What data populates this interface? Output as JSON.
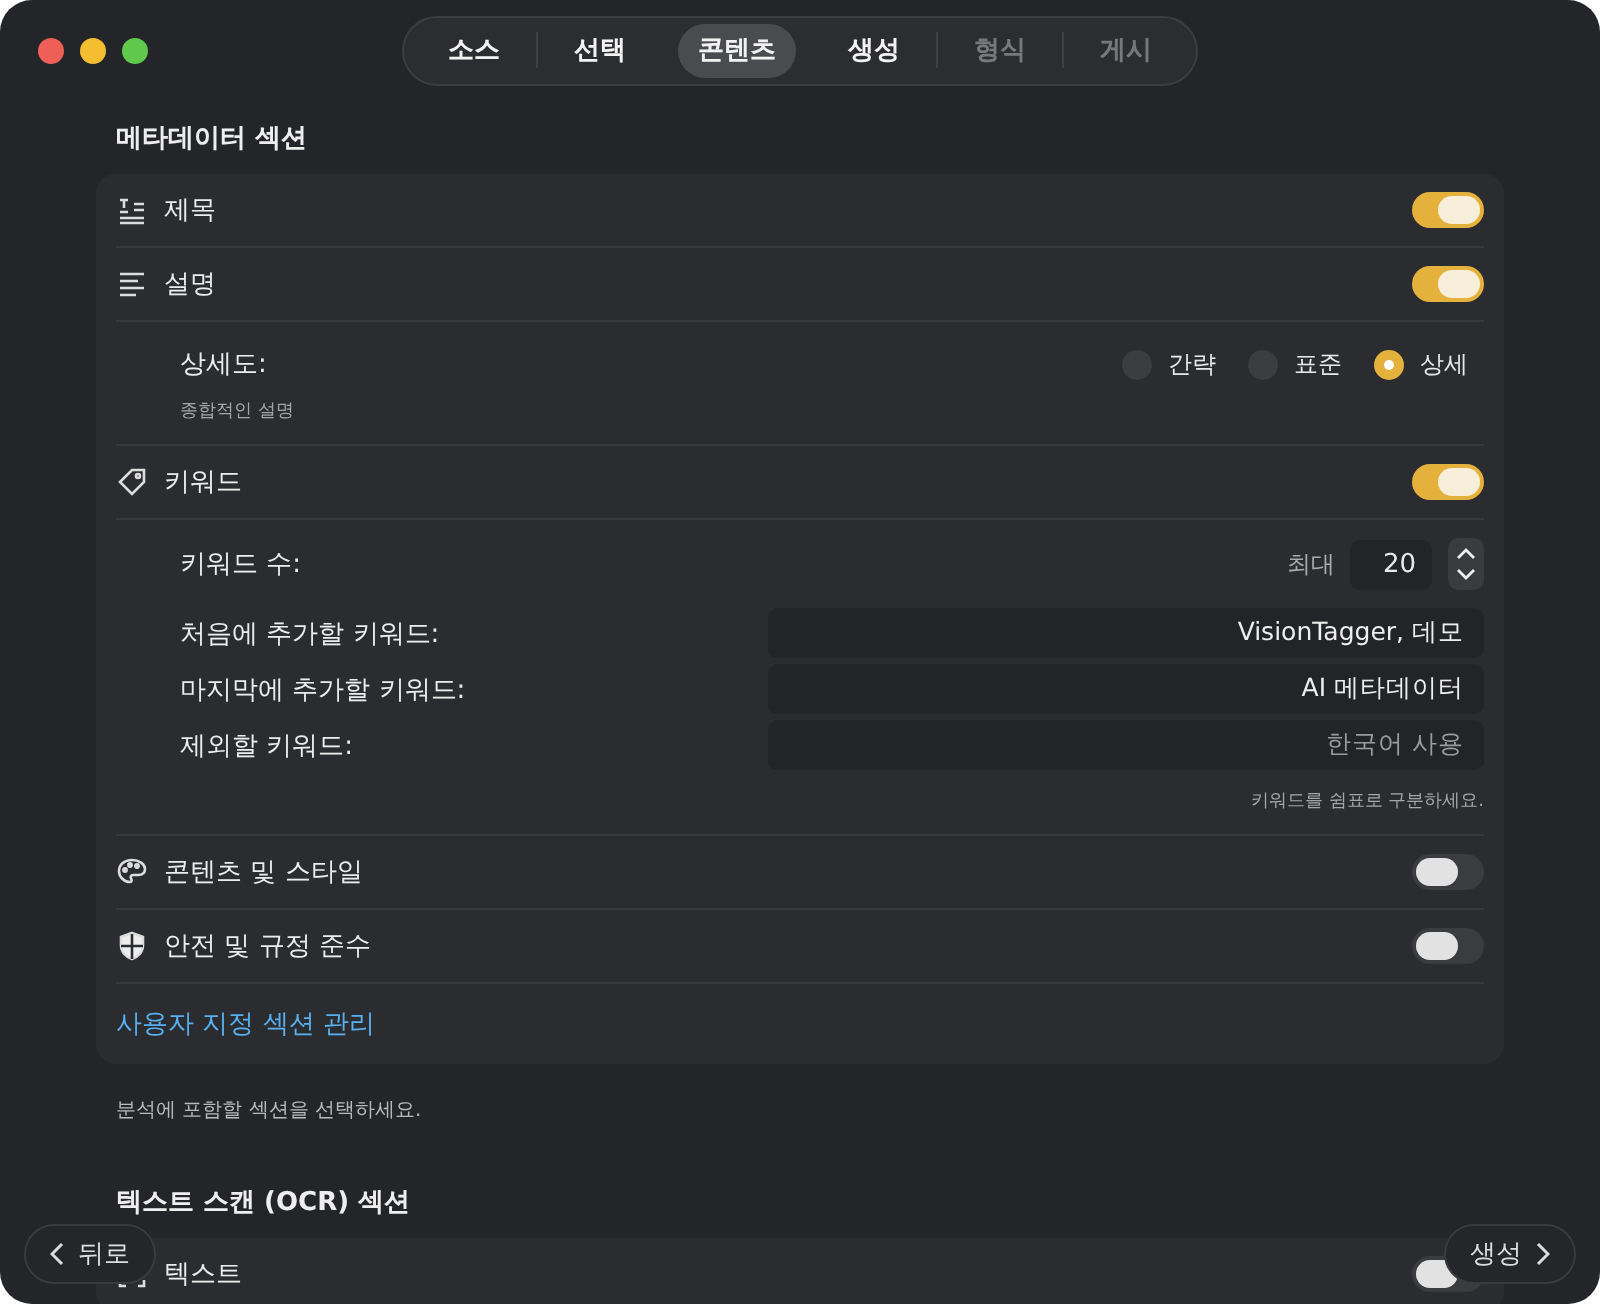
{
  "tabs": [
    {
      "label": "소스",
      "selected": false,
      "disabled": false
    },
    {
      "label": "선택",
      "selected": false,
      "disabled": false
    },
    {
      "label": "콘텐츠",
      "selected": true,
      "disabled": false
    },
    {
      "label": "생성",
      "selected": false,
      "disabled": false
    },
    {
      "label": "형식",
      "selected": false,
      "disabled": true
    },
    {
      "label": "게시",
      "selected": false,
      "disabled": true
    }
  ],
  "metadata_section": {
    "title": "메타데이터 섹션",
    "rows": [
      {
        "kind": "toggle",
        "label": "제목",
        "on": true
      },
      {
        "kind": "toggle",
        "label": "설명",
        "on": true
      },
      {
        "kind": "detail",
        "label": "상세도:",
        "sublabel": "종합적인 설명",
        "options": [
          {
            "label": "간략",
            "selected": false
          },
          {
            "label": "표준",
            "selected": false
          },
          {
            "label": "상세",
            "selected": true
          }
        ]
      },
      {
        "kind": "toggle",
        "label": "키워드",
        "on": true
      },
      {
        "kind": "keywords",
        "count_label": "키워드 수:",
        "max_label": "최대",
        "max_value": "20",
        "fields": [
          {
            "label": "처음에 추가할 키워드:",
            "value": "VisionTagger, 데모"
          },
          {
            "label": "마지막에 추가할 키워드:",
            "value": "AI 메타데이터"
          },
          {
            "label": "제외할 키워드:",
            "placeholder": "한국어 사용"
          }
        ],
        "hint": "키워드를 쉼표로 구분하세요."
      },
      {
        "kind": "toggle",
        "label": "콘텐츠 및 스타일",
        "on": false
      },
      {
        "kind": "toggle",
        "label": "안전 및 규정 준수",
        "on": false
      }
    ],
    "link": "사용자 지정 섹션 관리",
    "note": "분석에 포함할 섹션을 선택하세요."
  },
  "ocr_section": {
    "title": "텍스트 스캔 (OCR) 섹션",
    "rows": [
      {
        "kind": "toggle",
        "label": "텍스트",
        "on": false
      }
    ]
  },
  "footer": {
    "back": "뒤로",
    "next": "생성"
  }
}
